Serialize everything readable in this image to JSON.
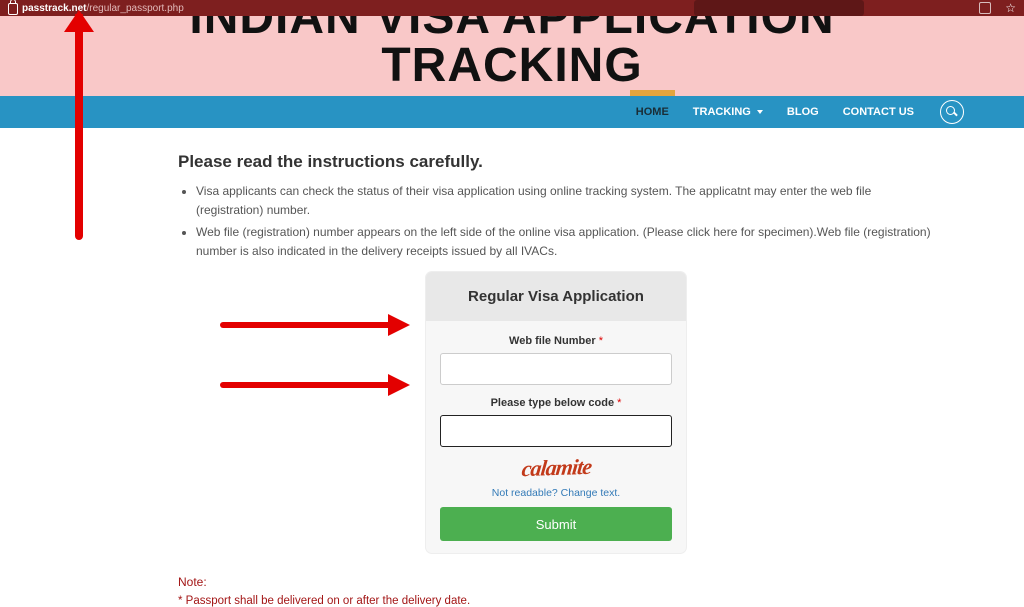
{
  "browser": {
    "url_host": "passtrack.net",
    "url_path": "/regular_passport.php"
  },
  "banner": {
    "title_line1": "INDIAN VISA APPLICATION",
    "title_line2": "TRACKING"
  },
  "nav": {
    "items": [
      {
        "label": "HOME",
        "active": true
      },
      {
        "label": "TRACKING",
        "active": false,
        "has_dropdown": true
      },
      {
        "label": "BLOG",
        "active": false
      },
      {
        "label": "CONTACT US",
        "active": false
      }
    ]
  },
  "instructions": {
    "heading": "Please read the instructions carefully.",
    "bullets": [
      "Visa applicants can check the status of their visa application using online tracking system. The applicatnt may enter the web file (registration) number.",
      "Web file (registration) number appears on the left side of the online visa application. (Please click here for specimen).Web file (registration) number is also indicated in the delivery receipts issued by all IVACs."
    ]
  },
  "form": {
    "title": "Regular Visa Application",
    "webfile_label": "Web file Number",
    "webfile_value": "",
    "captcha_label": "Please type below code",
    "captcha_value": "",
    "captcha_image_text": "calamite",
    "refresh_text": "Not readable? Change text.",
    "submit_label": "Submit",
    "required_mark": "*"
  },
  "note": {
    "heading": "Note:",
    "line1": "* Passport shall be delivered on or after the delivery date."
  }
}
